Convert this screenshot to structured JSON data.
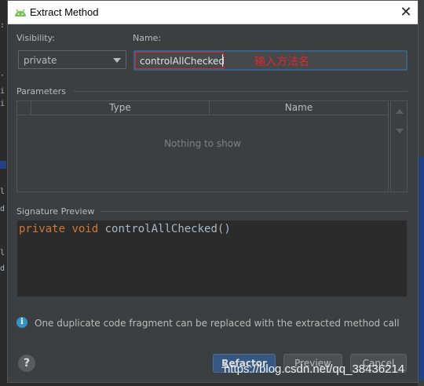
{
  "dialog": {
    "title": "Extract Method",
    "close_glyph": "✕",
    "app_icon": "android-icon"
  },
  "visibility": {
    "label": "Visibility:",
    "selected": "private"
  },
  "name": {
    "label": "Name:",
    "value": "controlAllChecked",
    "annotation": "输入方法名",
    "annotation_color": "#e1262d"
  },
  "parameters": {
    "label": "Parameters",
    "columns": [
      "Type",
      "Name"
    ],
    "empty_text": "Nothing to show"
  },
  "signature": {
    "label": "Signature Preview",
    "keyword1": "private",
    "keyword2": "void",
    "method": "controlAllChecked()"
  },
  "info": {
    "icon": "info-icon",
    "text": "One duplicate code fragment can be replaced with the extracted method call"
  },
  "buttons": {
    "help": "?",
    "refactor_underlined": "R",
    "refactor_rest": "efactor",
    "preview": "Preview",
    "cancel": "Cancel"
  },
  "watermark": "https://blog.csdn.net/qq_38436214",
  "colors": {
    "dialog_bg": "#3c3f41",
    "editor_bg": "#2b2b2b",
    "keyword": "#cc7832",
    "accent_button": "#365880"
  }
}
